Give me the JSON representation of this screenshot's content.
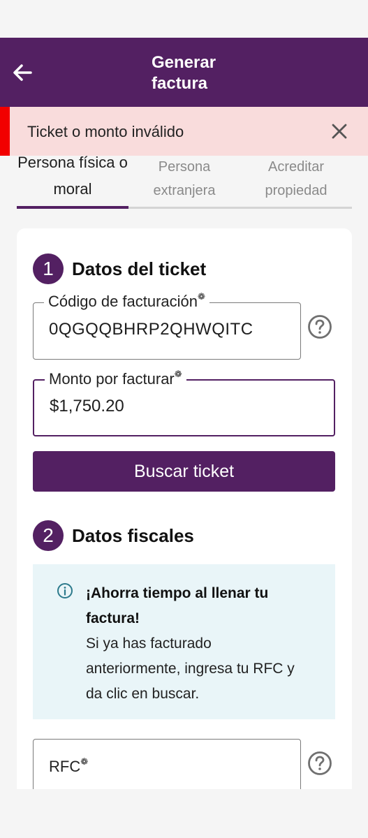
{
  "app_bar": {
    "title": "Generar factura"
  },
  "alert": {
    "message": "Ticket o monto inválido",
    "accent_color": "#f20000",
    "close_icon": "close-icon"
  },
  "tabs": [
    {
      "label": "Persona física o moral",
      "active": true
    },
    {
      "label": "Persona extranjera",
      "active": false
    },
    {
      "label": "Acreditar propiedad",
      "active": false
    }
  ],
  "step1": {
    "number": "1",
    "title": "Datos del ticket",
    "billing_code": {
      "label": "Código de facturación",
      "value": "0QGQQBHRP2QHWQITC"
    },
    "amount": {
      "label": "Monto por facturar",
      "value": "$1,750.20"
    },
    "search_button": "Buscar ticket"
  },
  "step2": {
    "number": "2",
    "title": "Datos fiscales",
    "info_title": "¡Ahorra tiempo al llenar tu factura!",
    "info_text": "Si ya has facturado anteriormente, ingresa tu RFC y da clic en buscar.",
    "rfc": {
      "placeholder": "RFC"
    }
  },
  "colors": {
    "brand": "#532062",
    "alert_bg": "#f9dcdc",
    "info_bg": "#e9f5f8"
  }
}
